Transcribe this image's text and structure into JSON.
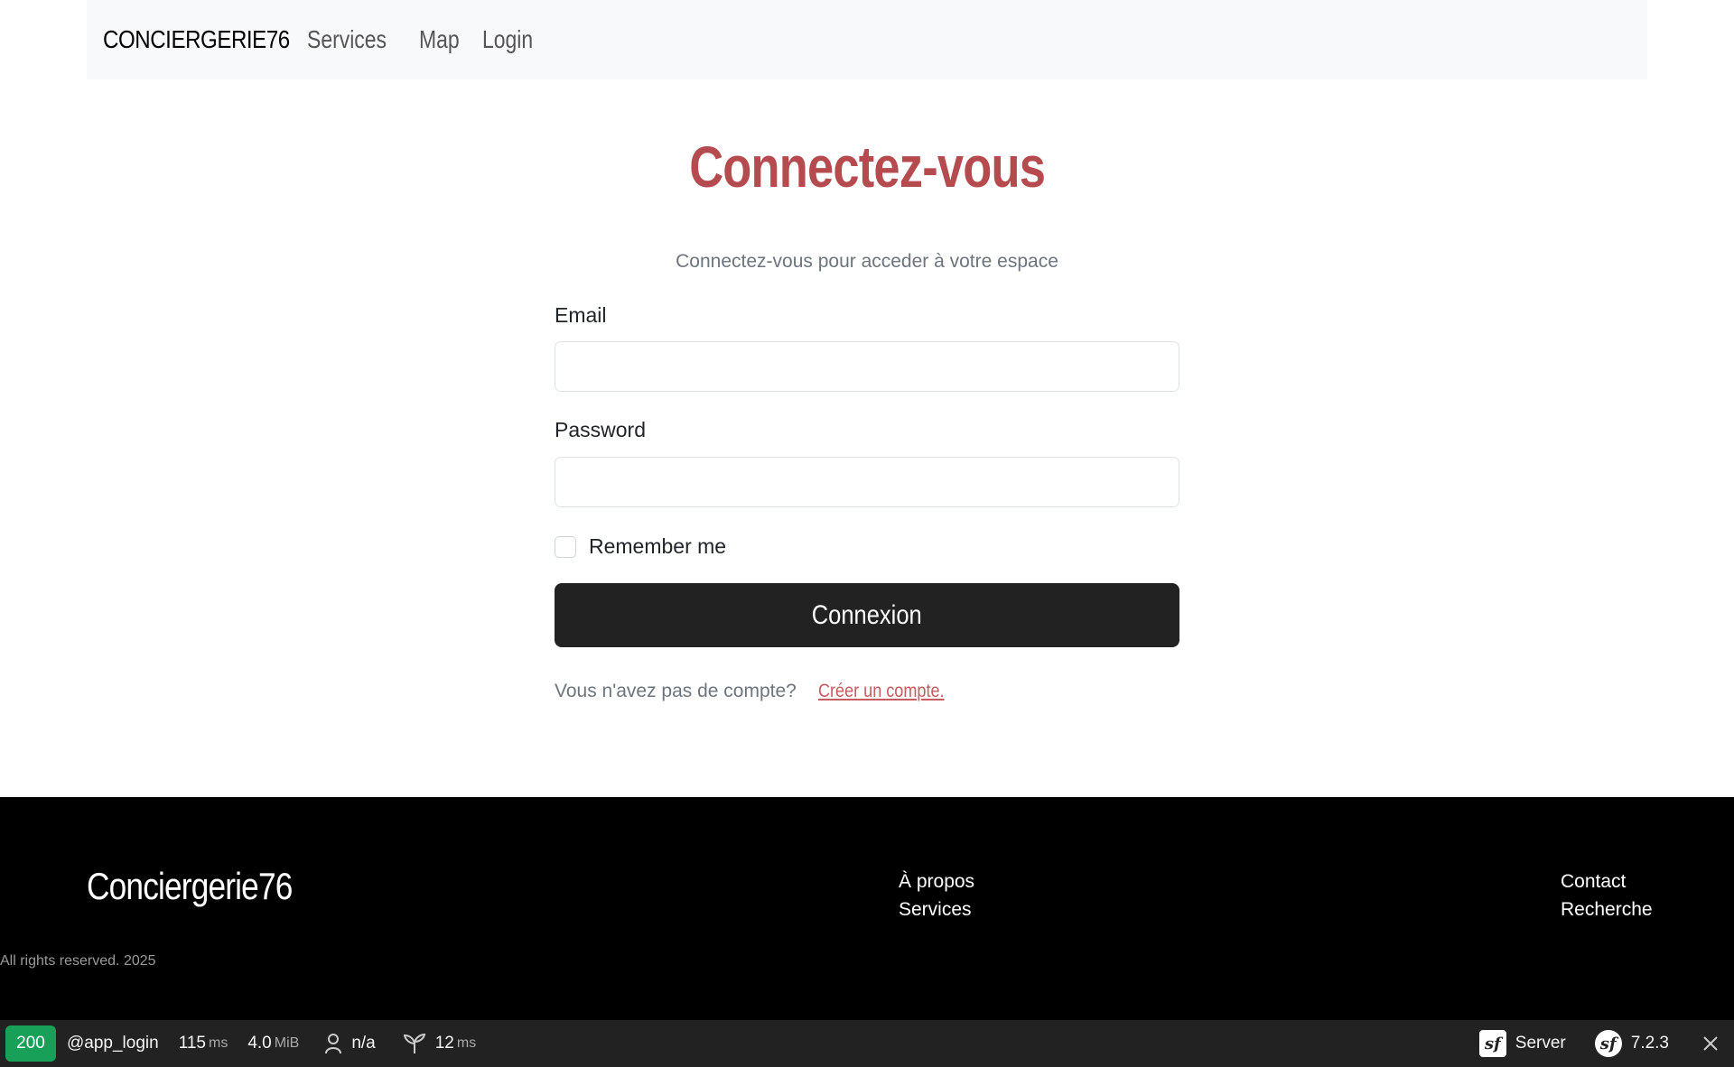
{
  "navbar": {
    "brand": "CONCIERGERIE76",
    "links": [
      "Services",
      "Map",
      "Login"
    ]
  },
  "login": {
    "title": "Connectez-vous",
    "subtitle": "Connectez-vous pour acceder à votre espace",
    "email_label": "Email",
    "email_value": "",
    "password_label": "Password",
    "password_value": "",
    "remember_label": "Remember me",
    "remember_checked": false,
    "submit_label": "Connexion",
    "no_account_text": "Vous n'avez pas de compte?",
    "create_account_link": "Créer un compte."
  },
  "footer": {
    "brand": "Conciergerie76",
    "col1": [
      "À propos",
      "Services"
    ],
    "col2": [
      "Contact",
      "Recherche"
    ],
    "copyright": "All rights reserved. 2025"
  },
  "debug_toolbar": {
    "status_code": "200",
    "route": "@app_login",
    "time_value": "115",
    "time_unit": "ms",
    "memory_value": "4.0",
    "memory_unit": "MiB",
    "user": "n/a",
    "twig_value": "12",
    "twig_unit": "ms",
    "server_label": "Server",
    "symfony_version": "7.2.3",
    "icons": [
      "user-icon",
      "twig-icon",
      "symfony-logo-icon",
      "close-icon"
    ]
  },
  "colors": {
    "title": "#b54b4e",
    "link": "#c85b5e",
    "button": "#222222",
    "status_ok": "#18a058",
    "footer_bg": "#000000",
    "navbar_bg": "#f8f9fa"
  }
}
